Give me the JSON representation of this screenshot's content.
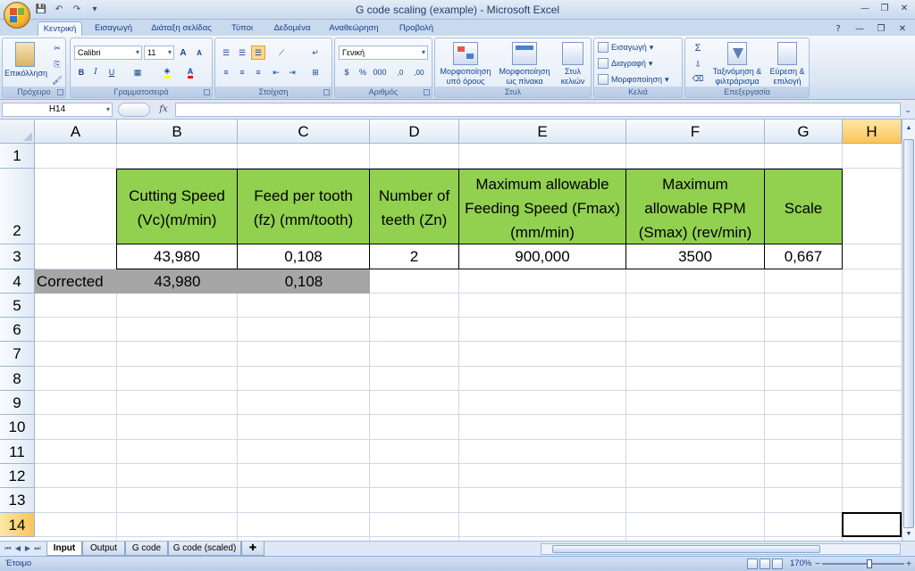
{
  "window": {
    "title": "G code scaling (example) - Microsoft Excel",
    "controls": {
      "minimize": "—",
      "maximize": "❐",
      "close": "✕"
    },
    "help": "?"
  },
  "ribbon": {
    "tabs": [
      {
        "label": "Κεντρική",
        "active": true
      },
      {
        "label": "Εισαγωγή"
      },
      {
        "label": "Διάταξη σελίδας"
      },
      {
        "label": "Τύποι"
      },
      {
        "label": "Δεδομένα"
      },
      {
        "label": "Αναθεώρηση"
      },
      {
        "label": "Προβολή"
      }
    ],
    "groups": {
      "clipboard": {
        "label": "Πρόχειρο",
        "paste": "Επικόλληση"
      },
      "font": {
        "label": "Γραμματοσειρά",
        "font_name": "Calibri",
        "font_size": "11",
        "bold": "B",
        "italic": "I",
        "underline": "U",
        "grow": "A",
        "shrink": "A",
        "font_color": "A"
      },
      "alignment": {
        "label": "Στοίχιση"
      },
      "number": {
        "label": "Αριθμός",
        "format": "Γενική",
        "currency": "$",
        "percent": "%",
        "thousands": "000",
        "inc_decimal": ",0",
        "dec_decimal": ",00"
      },
      "styles": {
        "label": "Στυλ",
        "conditional": "Μορφοποίηση υπό όρους",
        "table": "Μορφοποίηση ως πίνακα",
        "cell_styles": "Στυλ κελιών"
      },
      "cells": {
        "label": "Κελιά",
        "insert": "Εισαγωγή",
        "delete": "Διαγραφή",
        "format": "Μορφοποίηση"
      },
      "editing": {
        "label": "Επεξεργασία",
        "sum": "Σ",
        "sort": "Ταξινόμηση & φιλτράρισμα",
        "find": "Εύρεση & επιλογή"
      }
    }
  },
  "formula_bar": {
    "name_box": "H14",
    "fx": "fx",
    "content": ""
  },
  "columns": [
    "A",
    "B",
    "C",
    "D",
    "E",
    "F",
    "G",
    "H"
  ],
  "rows": [
    "1",
    "2",
    "3",
    "4",
    "5",
    "6",
    "7",
    "8",
    "9",
    "10",
    "11",
    "12",
    "13",
    "14"
  ],
  "selected": {
    "column": "H",
    "row": "14"
  },
  "table": {
    "headers": [
      [
        "Cutting Speed",
        "(Vc)(m/min)"
      ],
      [
        "Feed per tooth",
        "(fz) (mm/tooth)"
      ],
      [
        "Number of",
        "teeth (Zn)"
      ],
      [
        "Maximum allowable",
        "Feeding Speed (Fmax)",
        "(mm/min)"
      ],
      [
        "Maximum",
        "allowable RPM",
        "(Smax) (rev/min)"
      ],
      [
        "Scale"
      ]
    ],
    "values": [
      "43,980",
      "0,108",
      "2",
      "900,000",
      "3500",
      "0,667"
    ],
    "corrected_label": "Corrected",
    "corrected_values": [
      "43,980",
      "0,108"
    ]
  },
  "sheets": [
    {
      "label": "Input",
      "active": true
    },
    {
      "label": "Output"
    },
    {
      "label": "G code"
    },
    {
      "label": "G code (scaled)"
    }
  ],
  "status": {
    "text": "Έτοιμο",
    "zoom": "170%"
  },
  "colors": {
    "header_fill": "#92d050",
    "corrected_fill": "#a6a6a6",
    "selected_header": "#f8c55d"
  }
}
